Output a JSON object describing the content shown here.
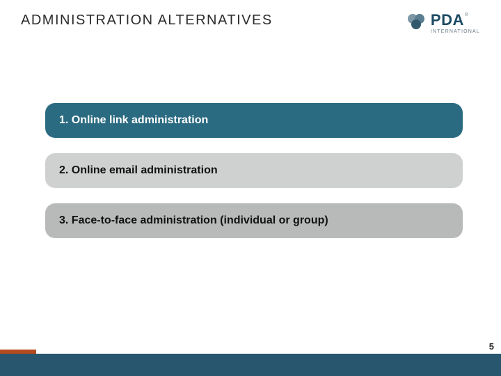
{
  "header": {
    "title": "ADMINISTRATION  ALTERNATIVES",
    "logo": {
      "name": "PDA",
      "sub": "INTERNATIONAL"
    }
  },
  "items": [
    {
      "label": "1. Online link administration"
    },
    {
      "label": "2. Online email administration"
    },
    {
      "label": "3. Face-to-face administration (individual or group)"
    }
  ],
  "page_number": "5",
  "colors": {
    "bar1": "#2b6b82",
    "bar2": "#cfd0d0",
    "bar3": "#b8b9b9",
    "footer": "#28566e",
    "accent": "#b44b1f"
  }
}
